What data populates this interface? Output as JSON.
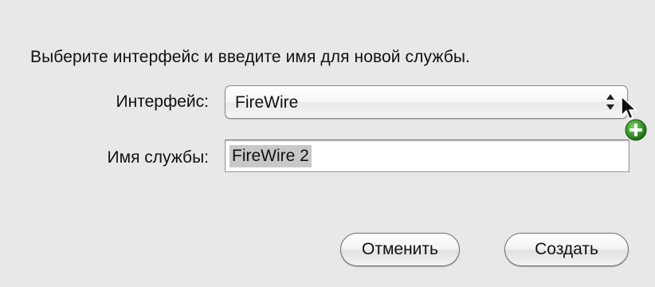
{
  "dialog": {
    "instruction": "Выберите интерфейс и введите имя для новой службы.",
    "interface_label": "Интерфейс:",
    "interface_value": "FireWire",
    "service_name_label": "Имя службы:",
    "service_name_value": "FireWire 2",
    "cancel_label": "Отменить",
    "create_label": "Создать"
  },
  "icons": {
    "popup_arrows": "up-down-arrows-icon",
    "cursor": "mouse-pointer-icon",
    "add_badge": "green-plus-icon"
  },
  "colors": {
    "background": "#e8e8e8",
    "selection": "#c8c8c8",
    "add_badge": "#3a9a2a"
  }
}
